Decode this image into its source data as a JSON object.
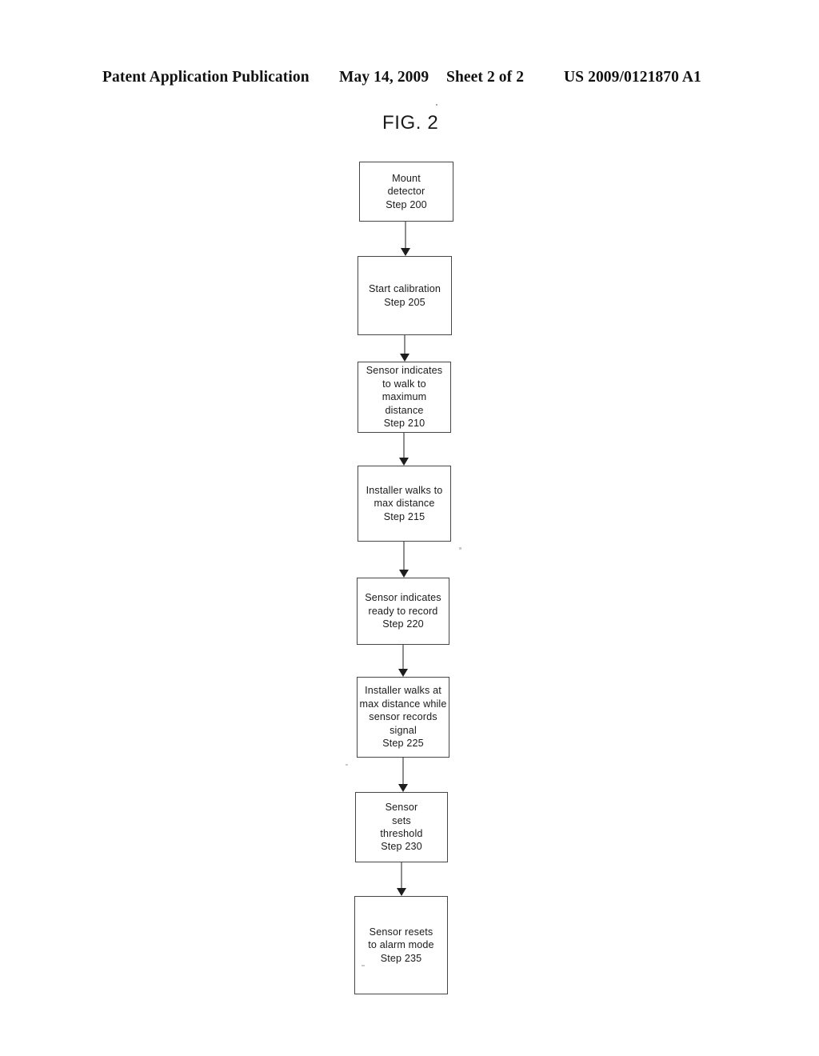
{
  "header": {
    "publication": "Patent Application Publication",
    "date": "May 14, 2009",
    "sheet": "Sheet 2 of 2",
    "document_number": "US 2009/0121870 A1"
  },
  "figure": {
    "title": "FIG. 2"
  },
  "diagram": {
    "type": "flowchart",
    "orientation": "vertical",
    "nodes": [
      {
        "id": "step-200",
        "step": "Step 200",
        "lines": [
          "Mount",
          "detector",
          "Step 200"
        ],
        "text": "Mount detector Step 200"
      },
      {
        "id": "step-205",
        "step": "Step 205",
        "lines": [
          "Start calibration",
          "Step 205"
        ],
        "text": "Start calibration Step 205"
      },
      {
        "id": "step-210",
        "step": "Step 210",
        "lines": [
          "Sensor indicates",
          "to walk to",
          "maximum",
          "distance",
          "Step 210"
        ],
        "text": "Sensor indicates to walk to maximum distance Step 210"
      },
      {
        "id": "step-215",
        "step": "Step 215",
        "lines": [
          "Installer walks to",
          "max distance",
          "Step 215"
        ],
        "text": "Installer walks to max distance Step 215"
      },
      {
        "id": "step-220",
        "step": "Step 220",
        "lines": [
          "Sensor indicates",
          "ready to record",
          "Step 220"
        ],
        "text": "Sensor indicates ready to record Step 220"
      },
      {
        "id": "step-225",
        "step": "Step 225",
        "lines": [
          "Installer walks at",
          "max distance while",
          "sensor records",
          "signal",
          "Step 225"
        ],
        "text": "Installer walks at max distance while sensor records signal Step 225"
      },
      {
        "id": "step-230",
        "step": "Step 230",
        "lines": [
          "Sensor",
          "sets",
          "threshold",
          "Step 230"
        ],
        "text": "Sensor sets threshold Step 230"
      },
      {
        "id": "step-235",
        "step": "Step 235",
        "lines": [
          "Sensor resets",
          "to alarm mode",
          "Step 235"
        ],
        "text": "Sensor resets to alarm mode Step 235"
      }
    ],
    "edges": [
      {
        "from": "step-200",
        "to": "step-205"
      },
      {
        "from": "step-205",
        "to": "step-210"
      },
      {
        "from": "step-210",
        "to": "step-215"
      },
      {
        "from": "step-215",
        "to": "step-220"
      },
      {
        "from": "step-220",
        "to": "step-225"
      },
      {
        "from": "step-225",
        "to": "step-230"
      },
      {
        "from": "step-230",
        "to": "step-235"
      }
    ]
  },
  "colors": {
    "ink": "#1a1a1a",
    "box_border": "#2b2b2b",
    "connector": "#8d8d8d",
    "arrowhead": "#1d1d1d",
    "page_background": "#ffffff"
  }
}
